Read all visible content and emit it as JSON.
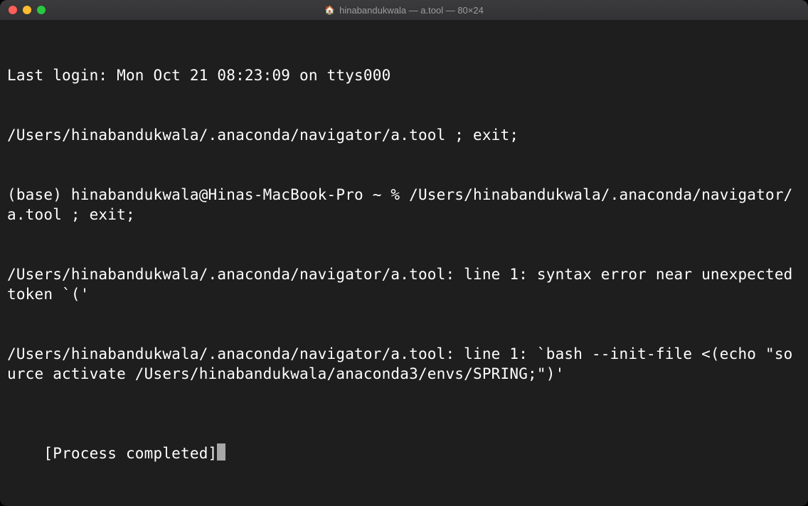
{
  "titlebar": {
    "icon": "🏠",
    "title": "hinabandukwala — a.tool — 80×24"
  },
  "terminal": {
    "lines": [
      "Last login: Mon Oct 21 08:23:09 on ttys000",
      "/Users/hinabandukwala/.anaconda/navigator/a.tool ; exit;",
      "(base) hinabandukwala@Hinas-MacBook-Pro ~ % /Users/hinabandukwala/.anaconda/navigator/a.tool ; exit;",
      "/Users/hinabandukwala/.anaconda/navigator/a.tool: line 1: syntax error near unexpected token `('",
      "/Users/hinabandukwala/.anaconda/navigator/a.tool: line 1: `bash --init-file <(echo \"source activate /Users/hinabandukwala/anaconda3/envs/SPRING;\")'",
      "",
      "[Process completed]"
    ]
  }
}
